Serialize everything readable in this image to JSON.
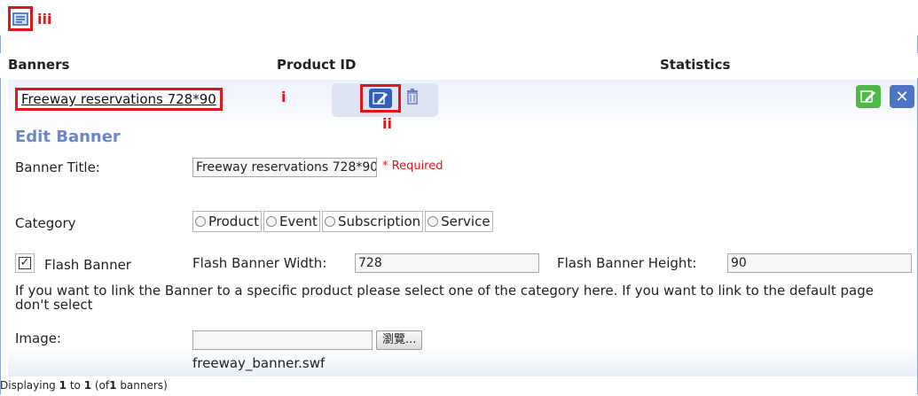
{
  "annotations": {
    "top": "iii",
    "title": "i",
    "edit": "ii"
  },
  "header": {
    "banners": "Banners",
    "product_id": "Product ID",
    "statistics": "Statistics"
  },
  "banner_row": {
    "title": "Freeway reservations 728*90"
  },
  "form": {
    "heading": "Edit Banner",
    "title_label": "Banner Title:",
    "title_value": "Freeway reservations 728*90",
    "required": "* Required",
    "category_label": "Category",
    "categories": [
      "Product",
      "Event",
      "Subscription",
      "Service"
    ],
    "flash_label": "Flash Banner",
    "flash_checked": "✓",
    "width_label": "Flash Banner Width:",
    "width_value": "728",
    "height_label": "Flash Banner Height:",
    "height_value": "90",
    "help_text": "If you want to link the Banner to a specific product please select one of the category here. If you want to link to the default page don't select",
    "image_label": "Image:",
    "browse_label": "瀏覽...",
    "file_name": "freeway_banner.swf"
  },
  "footer": {
    "prefix": "Displaying",
    "from": "1",
    "to_word": "to",
    "to": "1",
    "of_prefix": "(of",
    "total": "1",
    "suffix": "banners)"
  },
  "colors": {
    "accent_red": "#e0161c",
    "edit_blue": "#2f5fb8",
    "save_green": "#4cba44",
    "heading_blue": "#6d86c9"
  }
}
